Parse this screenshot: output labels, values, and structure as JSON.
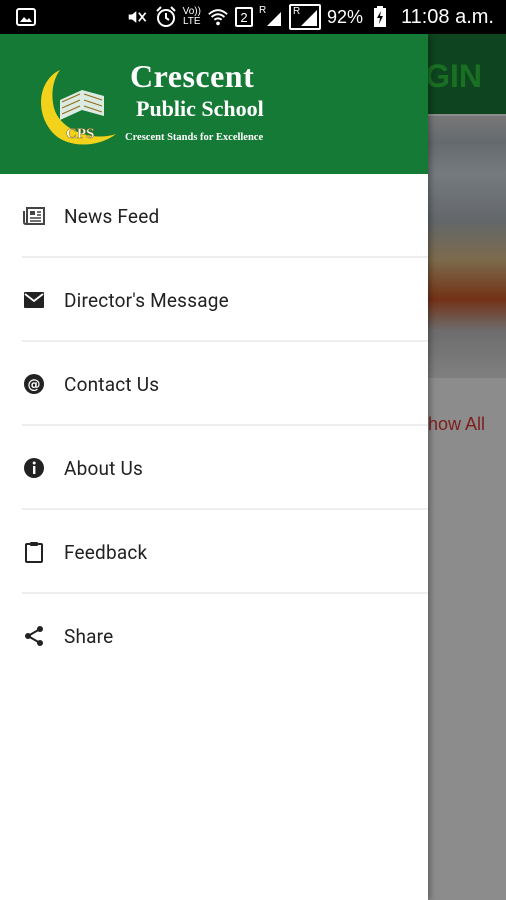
{
  "status_bar": {
    "volte_top": "Vo))",
    "volte_bottom": "LTE",
    "sim_number": "2",
    "roaming_1": "R",
    "roaming_2": "R",
    "battery": "92%",
    "time": "11:08 a.m."
  },
  "background_app": {
    "logo_text": "GIN",
    "show_all": "how All"
  },
  "drawer": {
    "header": {
      "crest_text": "CPS",
      "title": "Crescent",
      "subtitle": "Public School",
      "motto": "Crescent Stands for Excellence",
      "background_color": "#157a36"
    },
    "menu_items": [
      {
        "label": "News Feed",
        "icon": "newspaper-icon"
      },
      {
        "label": "Director's Message",
        "icon": "envelope-icon"
      },
      {
        "label": "Contact Us",
        "icon": "at-sign-icon"
      },
      {
        "label": "About Us",
        "icon": "info-icon"
      },
      {
        "label": "Feedback",
        "icon": "clipboard-icon"
      },
      {
        "label": "Share",
        "icon": "share-icon"
      }
    ]
  }
}
